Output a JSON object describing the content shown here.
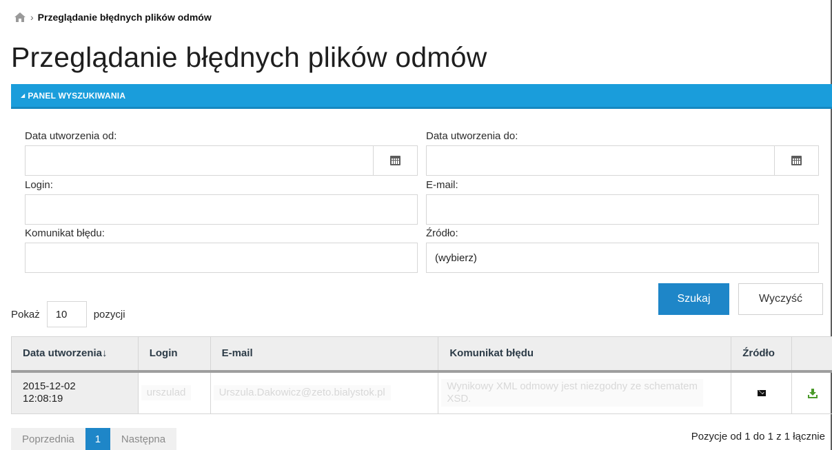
{
  "breadcrumb": {
    "current": "Przeglądanie błędnych plików odmów"
  },
  "page_title": "Przeglądanie błędnych plików odmów",
  "panel": {
    "title": "PANEL WYSZUKIWANIA"
  },
  "form": {
    "date_from_label": "Data utworzenia od:",
    "date_from_value": "",
    "date_to_label": "Data utworzenia do:",
    "date_to_value": "",
    "login_label": "Login:",
    "login_value": "",
    "email_label": "E-mail:",
    "email_value": "",
    "error_label": "Komunikat błędu:",
    "error_value": "",
    "source_label": "Źródło:",
    "source_value": "(wybierz)"
  },
  "buttons": {
    "search": "Szukaj",
    "clear": "Wyczyść"
  },
  "page_size": {
    "prefix": "Pokaż",
    "value": "10",
    "suffix": "pozycji"
  },
  "table": {
    "headers": [
      "Data utworzenia↓",
      "Login",
      "E-mail",
      "Komunikat błędu",
      "Źródło",
      ""
    ],
    "rows": [
      {
        "date": "2015-12-02",
        "time": "12:08:19",
        "login": "urszulad",
        "email": "Urszula.Dakowicz@zeto.bialystok.pl",
        "error": "Wynikowy XML odmowy jest niezgodny ze schematem XSD.",
        "source_icon": "mail-icon",
        "action_icon": "download-icon"
      }
    ]
  },
  "pagination": {
    "prev": "Poprzednia",
    "current": "1",
    "next": "Następna",
    "info": "Pozycje od 1 do 1 z 1 łącznie"
  },
  "colors": {
    "accent": "#1a9ddb",
    "button": "#1e86c8",
    "download": "#4a9a2a"
  }
}
